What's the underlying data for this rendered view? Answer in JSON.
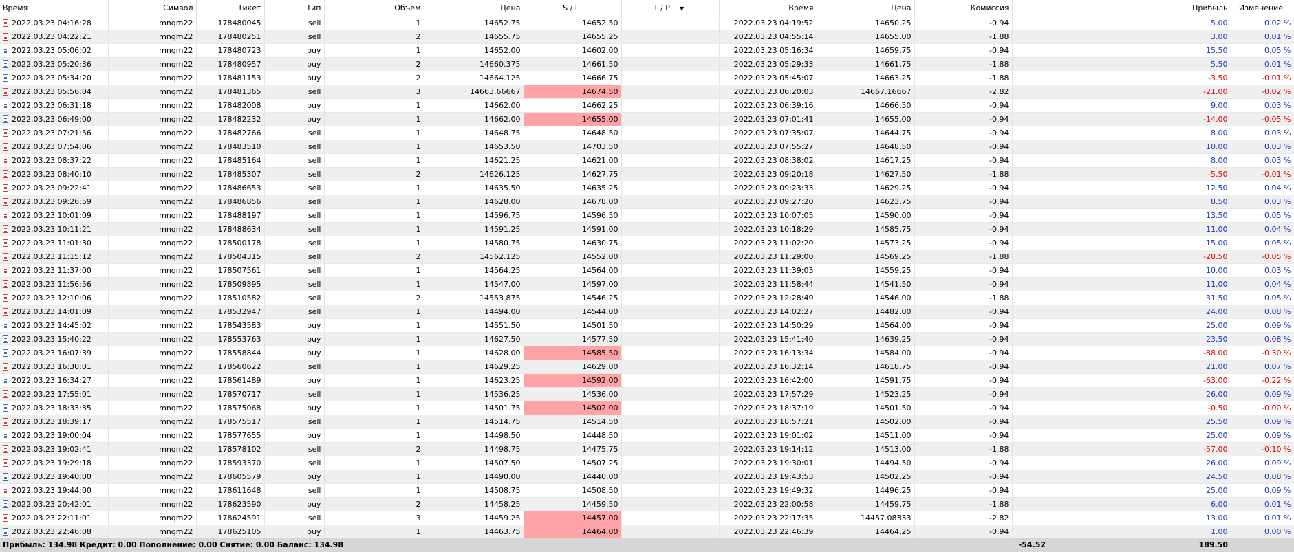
{
  "columns": {
    "open_time": "Время",
    "symbol": "Символ",
    "ticket": "Тикет",
    "type": "Тип",
    "volume": "Объем",
    "open_price": "Цена",
    "sl": "S / L",
    "tp": "T / P",
    "close_time": "Время",
    "close_price": "Цена",
    "commission": "Комиссия",
    "profit": "Прибыль",
    "change": "Изменение"
  },
  "colors": {
    "profit_positive": "#1b33c4",
    "profit_negative": "#e00000",
    "sl_hit_highlight": "#ffa3a6",
    "footer_bg": "#d6d6d6"
  },
  "rows": [
    {
      "open_time": "2022.03.23 04:16:28",
      "symbol": "mnqm22",
      "ticket": "178480045",
      "type": "sell",
      "volume": "1",
      "open_price": "14652.75",
      "sl": "14652.50",
      "sl_hit": false,
      "tp": "",
      "close_time": "2022.03.23 04:19:52",
      "close_price": "14650.25",
      "commission": "-0.94",
      "profit": "5.00",
      "change": "0.02 %"
    },
    {
      "open_time": "2022.03.23 04:22:21",
      "symbol": "mnqm22",
      "ticket": "178480251",
      "type": "sell",
      "volume": "2",
      "open_price": "14655.75",
      "sl": "14655.25",
      "sl_hit": false,
      "tp": "",
      "close_time": "2022.03.23 04:55:14",
      "close_price": "14655.00",
      "commission": "-1.88",
      "profit": "3.00",
      "change": "0.01 %"
    },
    {
      "open_time": "2022.03.23 05:06:02",
      "symbol": "mnqm22",
      "ticket": "178480723",
      "type": "buy",
      "volume": "1",
      "open_price": "14652.00",
      "sl": "14602.00",
      "sl_hit": false,
      "tp": "",
      "close_time": "2022.03.23 05:16:34",
      "close_price": "14659.75",
      "commission": "-0.94",
      "profit": "15.50",
      "change": "0.05 %"
    },
    {
      "open_time": "2022.03.23 05:20:36",
      "symbol": "mnqm22",
      "ticket": "178480957",
      "type": "buy",
      "volume": "2",
      "open_price": "14660.375",
      "sl": "14661.50",
      "sl_hit": false,
      "tp": "",
      "close_time": "2022.03.23 05:29:33",
      "close_price": "14661.75",
      "commission": "-1.88",
      "profit": "5.50",
      "change": "0.01 %"
    },
    {
      "open_time": "2022.03.23 05:34:20",
      "symbol": "mnqm22",
      "ticket": "178481153",
      "type": "buy",
      "volume": "2",
      "open_price": "14664.125",
      "sl": "14666.75",
      "sl_hit": false,
      "tp": "",
      "close_time": "2022.03.23 05:45:07",
      "close_price": "14663.25",
      "commission": "-1.88",
      "profit": "-3.50",
      "change": "-0.01 %"
    },
    {
      "open_time": "2022.03.23 05:56:04",
      "symbol": "mnqm22",
      "ticket": "178481365",
      "type": "sell",
      "volume": "3",
      "open_price": "14663.66667",
      "sl": "14674.50",
      "sl_hit": true,
      "tp": "",
      "close_time": "2022.03.23 06:20:03",
      "close_price": "14667.16667",
      "commission": "-2.82",
      "profit": "-21.00",
      "change": "-0.02 %"
    },
    {
      "open_time": "2022.03.23 06:31:18",
      "symbol": "mnqm22",
      "ticket": "178482008",
      "type": "buy",
      "volume": "1",
      "open_price": "14662.00",
      "sl": "14662.25",
      "sl_hit": false,
      "tp": "",
      "close_time": "2022.03.23 06:39:16",
      "close_price": "14666.50",
      "commission": "-0.94",
      "profit": "9.00",
      "change": "0.03 %"
    },
    {
      "open_time": "2022.03.23 06:49:00",
      "symbol": "mnqm22",
      "ticket": "178482232",
      "type": "buy",
      "volume": "1",
      "open_price": "14662.00",
      "sl": "14655.00",
      "sl_hit": true,
      "tp": "",
      "close_time": "2022.03.23 07:01:41",
      "close_price": "14655.00",
      "commission": "-0.94",
      "profit": "-14.00",
      "change": "-0.05 %"
    },
    {
      "open_time": "2022.03.23 07:21:56",
      "symbol": "mnqm22",
      "ticket": "178482766",
      "type": "sell",
      "volume": "1",
      "open_price": "14648.75",
      "sl": "14648.50",
      "sl_hit": false,
      "tp": "",
      "close_time": "2022.03.23 07:35:07",
      "close_price": "14644.75",
      "commission": "-0.94",
      "profit": "8.00",
      "change": "0.03 %"
    },
    {
      "open_time": "2022.03.23 07:54:06",
      "symbol": "mnqm22",
      "ticket": "178483510",
      "type": "sell",
      "volume": "1",
      "open_price": "14653.50",
      "sl": "14703.50",
      "sl_hit": false,
      "tp": "",
      "close_time": "2022.03.23 07:55:27",
      "close_price": "14648.50",
      "commission": "-0.94",
      "profit": "10.00",
      "change": "0.03 %"
    },
    {
      "open_time": "2022.03.23 08:37:22",
      "symbol": "mnqm22",
      "ticket": "178485164",
      "type": "sell",
      "volume": "1",
      "open_price": "14621.25",
      "sl": "14621.00",
      "sl_hit": false,
      "tp": "",
      "close_time": "2022.03.23 08:38:02",
      "close_price": "14617.25",
      "commission": "-0.94",
      "profit": "8.00",
      "change": "0.03 %"
    },
    {
      "open_time": "2022.03.23 08:40:10",
      "symbol": "mnqm22",
      "ticket": "178485307",
      "type": "sell",
      "volume": "2",
      "open_price": "14626.125",
      "sl": "14627.75",
      "sl_hit": false,
      "tp": "",
      "close_time": "2022.03.23 09:20:18",
      "close_price": "14627.50",
      "commission": "-1.88",
      "profit": "-5.50",
      "change": "-0.01 %"
    },
    {
      "open_time": "2022.03.23 09:22:41",
      "symbol": "mnqm22",
      "ticket": "178486653",
      "type": "sell",
      "volume": "1",
      "open_price": "14635.50",
      "sl": "14635.25",
      "sl_hit": false,
      "tp": "",
      "close_time": "2022.03.23 09:23:33",
      "close_price": "14629.25",
      "commission": "-0.94",
      "profit": "12.50",
      "change": "0.04 %"
    },
    {
      "open_time": "2022.03.23 09:26:59",
      "symbol": "mnqm22",
      "ticket": "178486856",
      "type": "sell",
      "volume": "1",
      "open_price": "14628.00",
      "sl": "14678.00",
      "sl_hit": false,
      "tp": "",
      "close_time": "2022.03.23 09:27:20",
      "close_price": "14623.75",
      "commission": "-0.94",
      "profit": "8.50",
      "change": "0.03 %"
    },
    {
      "open_time": "2022.03.23 10:01:09",
      "symbol": "mnqm22",
      "ticket": "178488197",
      "type": "sell",
      "volume": "1",
      "open_price": "14596.75",
      "sl": "14596.50",
      "sl_hit": false,
      "tp": "",
      "close_time": "2022.03.23 10:07:05",
      "close_price": "14590.00",
      "commission": "-0.94",
      "profit": "13.50",
      "change": "0.05 %"
    },
    {
      "open_time": "2022.03.23 10:11:21",
      "symbol": "mnqm22",
      "ticket": "178488634",
      "type": "sell",
      "volume": "1",
      "open_price": "14591.25",
      "sl": "14591.00",
      "sl_hit": false,
      "tp": "",
      "close_time": "2022.03.23 10:18:29",
      "close_price": "14585.75",
      "commission": "-0.94",
      "profit": "11.00",
      "change": "0.04 %"
    },
    {
      "open_time": "2022.03.23 11:01:30",
      "symbol": "mnqm22",
      "ticket": "178500178",
      "type": "sell",
      "volume": "1",
      "open_price": "14580.75",
      "sl": "14630.75",
      "sl_hit": false,
      "tp": "",
      "close_time": "2022.03.23 11:02:20",
      "close_price": "14573.25",
      "commission": "-0.94",
      "profit": "15.00",
      "change": "0.05 %"
    },
    {
      "open_time": "2022.03.23 11:15:12",
      "symbol": "mnqm22",
      "ticket": "178504315",
      "type": "sell",
      "volume": "2",
      "open_price": "14562.125",
      "sl": "14552.00",
      "sl_hit": false,
      "tp": "",
      "close_time": "2022.03.23 11:29:00",
      "close_price": "14569.25",
      "commission": "-1.88",
      "profit": "-28.50",
      "change": "-0.05 %"
    },
    {
      "open_time": "2022.03.23 11:37:00",
      "symbol": "mnqm22",
      "ticket": "178507561",
      "type": "sell",
      "volume": "1",
      "open_price": "14564.25",
      "sl": "14564.00",
      "sl_hit": false,
      "tp": "",
      "close_time": "2022.03.23 11:39:03",
      "close_price": "14559.25",
      "commission": "-0.94",
      "profit": "10.00",
      "change": "0.03 %"
    },
    {
      "open_time": "2022.03.23 11:56:56",
      "symbol": "mnqm22",
      "ticket": "178509895",
      "type": "sell",
      "volume": "1",
      "open_price": "14547.00",
      "sl": "14597.00",
      "sl_hit": false,
      "tp": "",
      "close_time": "2022.03.23 11:58:44",
      "close_price": "14541.50",
      "commission": "-0.94",
      "profit": "11.00",
      "change": "0.04 %"
    },
    {
      "open_time": "2022.03.23 12:10:06",
      "symbol": "mnqm22",
      "ticket": "178510582",
      "type": "sell",
      "volume": "2",
      "open_price": "14553.875",
      "sl": "14546.25",
      "sl_hit": false,
      "tp": "",
      "close_time": "2022.03.23 12:28:49",
      "close_price": "14546.00",
      "commission": "-1.88",
      "profit": "31.50",
      "change": "0.05 %"
    },
    {
      "open_time": "2022.03.23 14:01:09",
      "symbol": "mnqm22",
      "ticket": "178532947",
      "type": "sell",
      "volume": "1",
      "open_price": "14494.00",
      "sl": "14544.00",
      "sl_hit": false,
      "tp": "",
      "close_time": "2022.03.23 14:02:27",
      "close_price": "14482.00",
      "commission": "-0.94",
      "profit": "24.00",
      "change": "0.08 %"
    },
    {
      "open_time": "2022.03.23 14:45:02",
      "symbol": "mnqm22",
      "ticket": "178543583",
      "type": "buy",
      "volume": "1",
      "open_price": "14551.50",
      "sl": "14501.50",
      "sl_hit": false,
      "tp": "",
      "close_time": "2022.03.23 14:50:29",
      "close_price": "14564.00",
      "commission": "-0.94",
      "profit": "25.00",
      "change": "0.09 %"
    },
    {
      "open_time": "2022.03.23 15:40:22",
      "symbol": "mnqm22",
      "ticket": "178553763",
      "type": "buy",
      "volume": "1",
      "open_price": "14627.50",
      "sl": "14577.50",
      "sl_hit": false,
      "tp": "",
      "close_time": "2022.03.23 15:41:40",
      "close_price": "14639.25",
      "commission": "-0.94",
      "profit": "23.50",
      "change": "0.08 %"
    },
    {
      "open_time": "2022.03.23 16:07:39",
      "symbol": "mnqm22",
      "ticket": "178558844",
      "type": "buy",
      "volume": "1",
      "open_price": "14628.00",
      "sl": "14585.50",
      "sl_hit": true,
      "tp": "",
      "close_time": "2022.03.23 16:13:34",
      "close_price": "14584.00",
      "commission": "-0.94",
      "profit": "-88.00",
      "change": "-0.30 %"
    },
    {
      "open_time": "2022.03.23 16:30:01",
      "symbol": "mnqm22",
      "ticket": "178560622",
      "type": "sell",
      "volume": "1",
      "open_price": "14629.25",
      "sl": "14629.00",
      "sl_hit": false,
      "tp": "",
      "close_time": "2022.03.23 16:32:14",
      "close_price": "14618.75",
      "commission": "-0.94",
      "profit": "21.00",
      "change": "0.07 %"
    },
    {
      "open_time": "2022.03.23 16:34:27",
      "symbol": "mnqm22",
      "ticket": "178561489",
      "type": "buy",
      "volume": "1",
      "open_price": "14623.25",
      "sl": "14592.00",
      "sl_hit": true,
      "tp": "",
      "close_time": "2022.03.23 16:42:00",
      "close_price": "14591.75",
      "commission": "-0.94",
      "profit": "-63.00",
      "change": "-0.22 %"
    },
    {
      "open_time": "2022.03.23 17:55:01",
      "symbol": "mnqm22",
      "ticket": "178570717",
      "type": "sell",
      "volume": "1",
      "open_price": "14536.25",
      "sl": "14536.00",
      "sl_hit": false,
      "tp": "",
      "close_time": "2022.03.23 17:57:29",
      "close_price": "14523.25",
      "commission": "-0.94",
      "profit": "26.00",
      "change": "0.09 %"
    },
    {
      "open_time": "2022.03.23 18:33:35",
      "symbol": "mnqm22",
      "ticket": "178575068",
      "type": "buy",
      "volume": "1",
      "open_price": "14501.75",
      "sl": "14502.00",
      "sl_hit": true,
      "tp": "",
      "close_time": "2022.03.23 18:37:19",
      "close_price": "14501.50",
      "commission": "-0.94",
      "profit": "-0.50",
      "change": "-0.00 %"
    },
    {
      "open_time": "2022.03.23 18:39:17",
      "symbol": "mnqm22",
      "ticket": "178575517",
      "type": "sell",
      "volume": "1",
      "open_price": "14514.75",
      "sl": "14514.50",
      "sl_hit": false,
      "tp": "",
      "close_time": "2022.03.23 18:57:21",
      "close_price": "14502.00",
      "commission": "-0.94",
      "profit": "25.50",
      "change": "0.09 %"
    },
    {
      "open_time": "2022.03.23 19:00:04",
      "symbol": "mnqm22",
      "ticket": "178577655",
      "type": "buy",
      "volume": "1",
      "open_price": "14498.50",
      "sl": "14448.50",
      "sl_hit": false,
      "tp": "",
      "close_time": "2022.03.23 19:01:02",
      "close_price": "14511.00",
      "commission": "-0.94",
      "profit": "25.00",
      "change": "0.09 %"
    },
    {
      "open_time": "2022.03.23 19:02:41",
      "symbol": "mnqm22",
      "ticket": "178578102",
      "type": "sell",
      "volume": "2",
      "open_price": "14498.75",
      "sl": "14475.75",
      "sl_hit": false,
      "tp": "",
      "close_time": "2022.03.23 19:14:12",
      "close_price": "14513.00",
      "commission": "-1.88",
      "profit": "-57.00",
      "change": "-0.10 %"
    },
    {
      "open_time": "2022.03.23 19:29:18",
      "symbol": "mnqm22",
      "ticket": "178593370",
      "type": "sell",
      "volume": "1",
      "open_price": "14507.50",
      "sl": "14507.25",
      "sl_hit": false,
      "tp": "",
      "close_time": "2022.03.23 19:30:01",
      "close_price": "14494.50",
      "commission": "-0.94",
      "profit": "26.00",
      "change": "0.09 %"
    },
    {
      "open_time": "2022.03.23 19:40:00",
      "symbol": "mnqm22",
      "ticket": "178605579",
      "type": "buy",
      "volume": "1",
      "open_price": "14490.00",
      "sl": "14440.00",
      "sl_hit": false,
      "tp": "",
      "close_time": "2022.03.23 19:43:53",
      "close_price": "14502.25",
      "commission": "-0.94",
      "profit": "24.50",
      "change": "0.08 %"
    },
    {
      "open_time": "2022.03.23 19:44:00",
      "symbol": "mnqm22",
      "ticket": "178611648",
      "type": "sell",
      "volume": "1",
      "open_price": "14508.75",
      "sl": "14508.50",
      "sl_hit": false,
      "tp": "",
      "close_time": "2022.03.23 19:49:32",
      "close_price": "14496.25",
      "commission": "-0.94",
      "profit": "25.00",
      "change": "0.09 %"
    },
    {
      "open_time": "2022.03.23 20:42:01",
      "symbol": "mnqm22",
      "ticket": "178623590",
      "type": "buy",
      "volume": "2",
      "open_price": "14458.25",
      "sl": "14459.50",
      "sl_hit": false,
      "tp": "",
      "close_time": "2022.03.23 22:00:58",
      "close_price": "14459.75",
      "commission": "-1.88",
      "profit": "6.00",
      "change": "0.01 %"
    },
    {
      "open_time": "2022.03.23 22:11:01",
      "symbol": "mnqm22",
      "ticket": "178624591",
      "type": "sell",
      "volume": "3",
      "open_price": "14459.25",
      "sl": "14457.00",
      "sl_hit": true,
      "tp": "",
      "close_time": "2022.03.23 22:17:35",
      "close_price": "14457.08333",
      "commission": "-2.82",
      "profit": "13.00",
      "change": "0.01 %"
    },
    {
      "open_time": "2022.03.23 22:46:08",
      "symbol": "mnqm22",
      "ticket": "178625105",
      "type": "buy",
      "volume": "1",
      "open_price": "14463.75",
      "sl": "14464.00",
      "sl_hit": true,
      "tp": "",
      "close_time": "2022.03.23 22:46:39",
      "close_price": "14464.25",
      "commission": "-0.94",
      "profit": "1.00",
      "change": "0.00 %"
    }
  ],
  "footer": {
    "summary": "Прибыль: 134.98  Кредит: 0.00  Пополнение: 0.00  Снятие: 0.00  Баланс: 134.98",
    "total_commission": "-54.52",
    "total_profit": "189.50"
  }
}
